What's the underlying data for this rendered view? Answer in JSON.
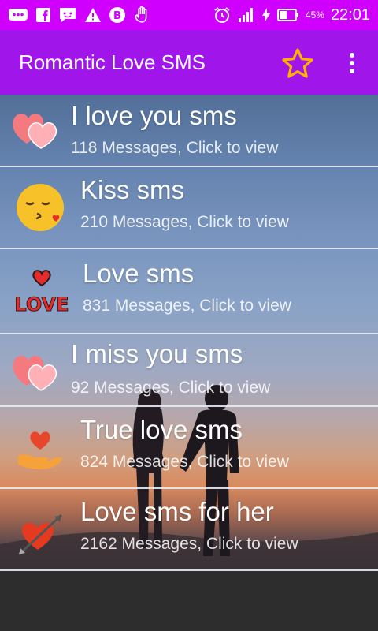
{
  "status_bar": {
    "battery": "45%",
    "time": "22:01",
    "icons": [
      "messages-icon",
      "facebook-icon",
      "chat-icon",
      "warning-icon",
      "b-app-icon",
      "hand-icon",
      "alarm-icon",
      "signal-icon",
      "charging-icon",
      "battery-icon"
    ]
  },
  "app_bar": {
    "title": "Romantic Love SMS",
    "star_icon": "star-outline-icon",
    "menu_icon": "more-vert-icon",
    "color": "#a016ea"
  },
  "categories": [
    {
      "title": "I love you sms",
      "subtitle": "118 Messages, Click to view",
      "icon": "two-hearts-icon"
    },
    {
      "title": "Kiss sms",
      "subtitle": "210 Messages, Click to view",
      "icon": "kiss-emoji-icon"
    },
    {
      "title": "Love sms",
      "subtitle": "831 Messages, Click to view",
      "icon": "love-sticker-icon"
    },
    {
      "title": "I miss you sms",
      "subtitle": "92 Messages, Click to view",
      "icon": "two-hearts-icon"
    },
    {
      "title": "True love sms",
      "subtitle": "824 Messages, Click to view",
      "icon": "heart-in-hand-icon"
    },
    {
      "title": "Love sms for her",
      "subtitle": "2162 Messages, Click to view",
      "icon": "heart-arrow-icon"
    }
  ]
}
